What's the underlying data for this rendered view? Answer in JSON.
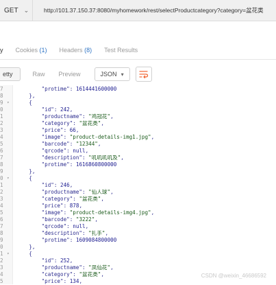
{
  "request": {
    "method": "GET",
    "url": "http://101.37.150.37:8080/myhomework/rest/selectProductcategory?category=盆花类"
  },
  "response_tabs": [
    {
      "label": "y",
      "count": ""
    },
    {
      "label": "Cookies",
      "count": "(1)"
    },
    {
      "label": "Headers",
      "count": "(8)"
    },
    {
      "label": "Test Results",
      "count": ""
    }
  ],
  "toolbar": {
    "pretty": "etty",
    "raw": "Raw",
    "preview": "Preview",
    "format": "JSON"
  },
  "code_lines": [
    {
      "num": "7",
      "fold": "",
      "parts": [
        [
          "        \"protime\": ",
          "k"
        ],
        [
          "1614441600000",
          "n"
        ]
      ]
    },
    {
      "num": "8",
      "fold": "",
      "parts": [
        [
          "    },",
          "k"
        ]
      ]
    },
    {
      "num": "9",
      "fold": "▾",
      "parts": [
        [
          "    {",
          "k"
        ]
      ]
    },
    {
      "num": "0",
      "fold": "",
      "parts": [
        [
          "        \"id\": ",
          "k"
        ],
        [
          "242",
          "n"
        ],
        [
          ",",
          "k"
        ]
      ]
    },
    {
      "num": "1",
      "fold": "",
      "parts": [
        [
          "        \"productname\": ",
          "k"
        ],
        [
          "\"鸡冠花\"",
          "s"
        ],
        [
          ",",
          "k"
        ]
      ]
    },
    {
      "num": "2",
      "fold": "",
      "parts": [
        [
          "        \"category\": ",
          "k"
        ],
        [
          "\"盆花类\"",
          "s"
        ],
        [
          ",",
          "k"
        ]
      ]
    },
    {
      "num": "3",
      "fold": "",
      "parts": [
        [
          "        \"price\": ",
          "k"
        ],
        [
          "66",
          "n"
        ],
        [
          ",",
          "k"
        ]
      ]
    },
    {
      "num": "4",
      "fold": "",
      "parts": [
        [
          "        \"image\": ",
          "k"
        ],
        [
          "\"product-details-img1.jpg\"",
          "s"
        ],
        [
          ",",
          "k"
        ]
      ]
    },
    {
      "num": "5",
      "fold": "",
      "parts": [
        [
          "        \"barcode\": ",
          "k"
        ],
        [
          "\"12344\"",
          "s"
        ],
        [
          ",",
          "k"
        ]
      ]
    },
    {
      "num": "6",
      "fold": "",
      "parts": [
        [
          "        \"qrcode\": ",
          "k"
        ],
        [
          "null",
          "nl"
        ],
        [
          ",",
          "k"
        ]
      ]
    },
    {
      "num": "7",
      "fold": "",
      "parts": [
        [
          "        \"description\": ",
          "k"
        ],
        [
          "\"叽叽叽叽及\"",
          "s"
        ],
        [
          ",",
          "k"
        ]
      ]
    },
    {
      "num": "8",
      "fold": "",
      "parts": [
        [
          "        \"protime\": ",
          "k"
        ],
        [
          "1616860800000",
          "n"
        ]
      ]
    },
    {
      "num": "9",
      "fold": "",
      "parts": [
        [
          "    },",
          "k"
        ]
      ]
    },
    {
      "num": "0",
      "fold": "▾",
      "parts": [
        [
          "    {",
          "k"
        ]
      ]
    },
    {
      "num": "1",
      "fold": "",
      "parts": [
        [
          "        \"id\": ",
          "k"
        ],
        [
          "246",
          "n"
        ],
        [
          ",",
          "k"
        ]
      ]
    },
    {
      "num": "2",
      "fold": "",
      "parts": [
        [
          "        \"productname\": ",
          "k"
        ],
        [
          "\"仙人球\"",
          "s"
        ],
        [
          ",",
          "k"
        ]
      ]
    },
    {
      "num": "3",
      "fold": "",
      "parts": [
        [
          "        \"category\": ",
          "k"
        ],
        [
          "\"盆花类\"",
          "s"
        ],
        [
          ",",
          "k"
        ]
      ]
    },
    {
      "num": "4",
      "fold": "",
      "parts": [
        [
          "        \"price\": ",
          "k"
        ],
        [
          "878",
          "n"
        ],
        [
          ",",
          "k"
        ]
      ]
    },
    {
      "num": "5",
      "fold": "",
      "parts": [
        [
          "        \"image\": ",
          "k"
        ],
        [
          "\"product-details-img4.jpg\"",
          "s"
        ],
        [
          ",",
          "k"
        ]
      ]
    },
    {
      "num": "6",
      "fold": "",
      "parts": [
        [
          "        \"barcode\": ",
          "k"
        ],
        [
          "\"3222\"",
          "s"
        ],
        [
          ",",
          "k"
        ]
      ]
    },
    {
      "num": "7",
      "fold": "",
      "parts": [
        [
          "        \"qrcode\": ",
          "k"
        ],
        [
          "null",
          "nl"
        ],
        [
          ",",
          "k"
        ]
      ]
    },
    {
      "num": "8",
      "fold": "",
      "parts": [
        [
          "        \"description\": ",
          "k"
        ],
        [
          "\"扎手\"",
          "s"
        ],
        [
          ",",
          "k"
        ]
      ]
    },
    {
      "num": "9",
      "fold": "",
      "parts": [
        [
          "        \"protime\": ",
          "k"
        ],
        [
          "1609084800000",
          "n"
        ]
      ]
    },
    {
      "num": "0",
      "fold": "",
      "parts": [
        [
          "    },",
          "k"
        ]
      ]
    },
    {
      "num": "1",
      "fold": "▾",
      "parts": [
        [
          "    {",
          "k"
        ]
      ]
    },
    {
      "num": "2",
      "fold": "",
      "parts": [
        [
          "        \"id\": ",
          "k"
        ],
        [
          "252",
          "n"
        ],
        [
          ",",
          "k"
        ]
      ]
    },
    {
      "num": "3",
      "fold": "",
      "parts": [
        [
          "        \"productname\": ",
          "k"
        ],
        [
          "\"凤仙花\"",
          "s"
        ],
        [
          ",",
          "k"
        ]
      ]
    },
    {
      "num": "4",
      "fold": "",
      "parts": [
        [
          "        \"category\": ",
          "k"
        ],
        [
          "\"盆花类\"",
          "s"
        ],
        [
          ",",
          "k"
        ]
      ]
    },
    {
      "num": "5",
      "fold": "",
      "parts": [
        [
          "        \"price\": ",
          "k"
        ],
        [
          "134",
          "n"
        ],
        [
          ",",
          "k"
        ]
      ]
    }
  ],
  "watermark": "CSDN @weixin_46686592",
  "colors": {
    "accent": "#f26b3a",
    "count": "#2d73c4"
  },
  "icons": {
    "method_dropdown": "chevron-down-icon",
    "format_dropdown": "chevron-down-icon",
    "wrap": "wrap-lines-icon"
  }
}
